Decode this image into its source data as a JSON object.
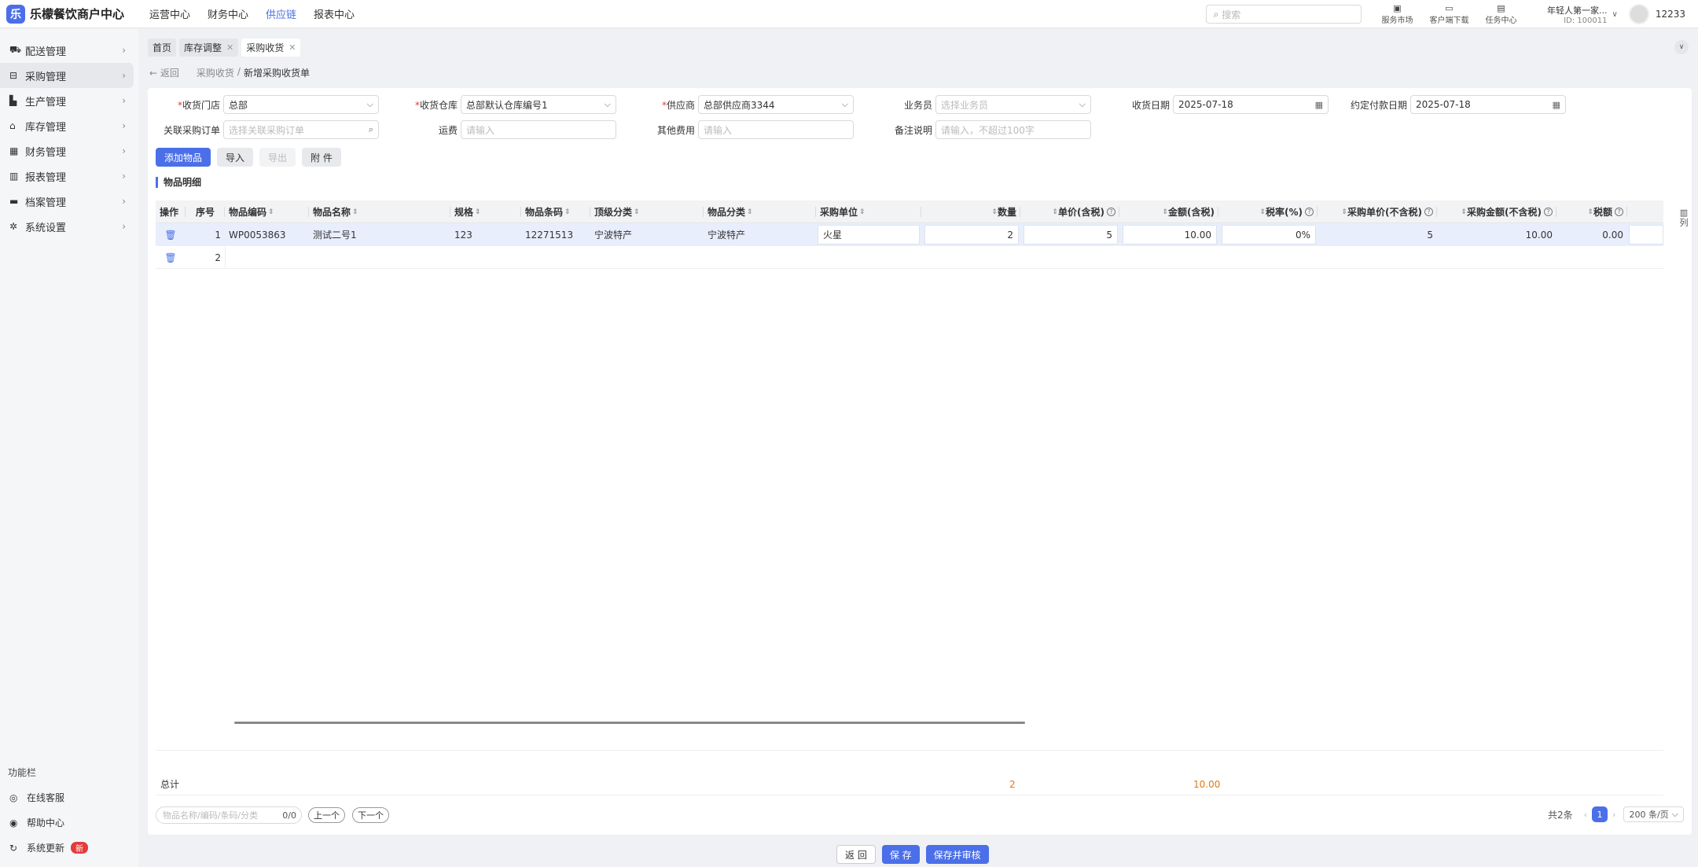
{
  "app": {
    "title": "乐檬餐饮商户中心",
    "logo_glyph": "乐"
  },
  "topnav": [
    "运营中心",
    "财务中心",
    "供应链",
    "报表中心"
  ],
  "search": {
    "placeholder": "搜索"
  },
  "tools": [
    {
      "label": "服务市场",
      "icon": "bag-icon"
    },
    {
      "label": "客户端下载",
      "icon": "download-icon"
    },
    {
      "label": "任务中心",
      "icon": "clipboard-icon"
    }
  ],
  "store": {
    "name": "年轻人第一家...",
    "id": "ID: 100011"
  },
  "user": {
    "name": "12233"
  },
  "sidebar": {
    "items": [
      {
        "label": "配送管理",
        "icon": "truck-icon"
      },
      {
        "label": "采购管理",
        "icon": "cart-icon"
      },
      {
        "label": "生产管理",
        "icon": "factory-icon"
      },
      {
        "label": "库存管理",
        "icon": "warehouse-icon"
      },
      {
        "label": "财务管理",
        "icon": "finance-icon"
      },
      {
        "label": "报表管理",
        "icon": "report-icon"
      },
      {
        "label": "档案管理",
        "icon": "archive-icon"
      },
      {
        "label": "系统设置",
        "icon": "gear-icon"
      }
    ],
    "func_title": "功能栏",
    "func_items": [
      {
        "label": "在线客服",
        "icon": "headset-icon"
      },
      {
        "label": "帮助中心",
        "icon": "help-icon"
      },
      {
        "label": "系统更新",
        "icon": "refresh-icon",
        "badge": "新"
      }
    ]
  },
  "tabs": [
    {
      "label": "首页"
    },
    {
      "label": "库存调整"
    },
    {
      "label": "采购收货"
    }
  ],
  "breadcrumb": {
    "back": "返回",
    "parent": "采购收货",
    "current": "新增采购收货单"
  },
  "form": {
    "store_label": "收货门店",
    "store_value": "总部",
    "warehouse_label": "收货仓库",
    "warehouse_value": "总部默认仓库编号1",
    "supplier_label": "供应商",
    "supplier_value": "总部供应商3344",
    "salesman_label": "业务员",
    "salesman_placeholder": "选择业务员",
    "date_label": "收货日期",
    "date_value": "2025-07-18",
    "pay_date_label": "约定付款日期",
    "pay_date_value": "2025-07-18",
    "order_label": "关联采购订单",
    "order_placeholder": "选择关联采购订单",
    "freight_label": "运费",
    "freight_placeholder": "请输入",
    "other_fee_label": "其他费用",
    "other_fee_placeholder": "请输入",
    "remark_label": "备注说明",
    "remark_placeholder": "请输入，不超过100字"
  },
  "actions": {
    "add": "添加物品",
    "import": "导入",
    "export": "导出",
    "attach": "附 件"
  },
  "section_title": "物品明细",
  "table": {
    "headers": [
      "操作",
      "序号",
      "物品编码",
      "物品名称",
      "规格",
      "物品条码",
      "顶级分类",
      "物品分类",
      "采购单位",
      "数量",
      "单价(含税)",
      "金额(含税)",
      "税率(%)",
      "采购单价(不含税)",
      "采购金额(不含税)",
      "税额"
    ],
    "rows": [
      {
        "seq": "1",
        "code": "WP0053863",
        "name": "测试二号1",
        "spec": "123",
        "barcode": "12271513",
        "top_cat": "宁波特产",
        "cat": "宁波特产",
        "unit": "火星",
        "qty": "2",
        "price": "5",
        "amount": "10.00",
        "tax_rate": "0%",
        "net_price": "5",
        "net_amount": "10.00",
        "tax": "0.00"
      },
      {
        "seq": "2"
      }
    ],
    "column_toggle": "列",
    "total_label": "总计",
    "total_qty": "2",
    "total_amount": "10.00"
  },
  "find": {
    "placeholder": "物品名称/编码/条码/分类",
    "count": "0/0",
    "prev": "上一个",
    "next": "下一个"
  },
  "pagination": {
    "total": "共2条",
    "page": "1",
    "size": "200 条/页"
  },
  "footer": {
    "back": "返 回",
    "save": "保 存",
    "save_audit": "保存并审核"
  },
  "colors": {
    "accent": "#4b6fe8",
    "total": "#e07a16",
    "danger": "#e23c3c"
  }
}
